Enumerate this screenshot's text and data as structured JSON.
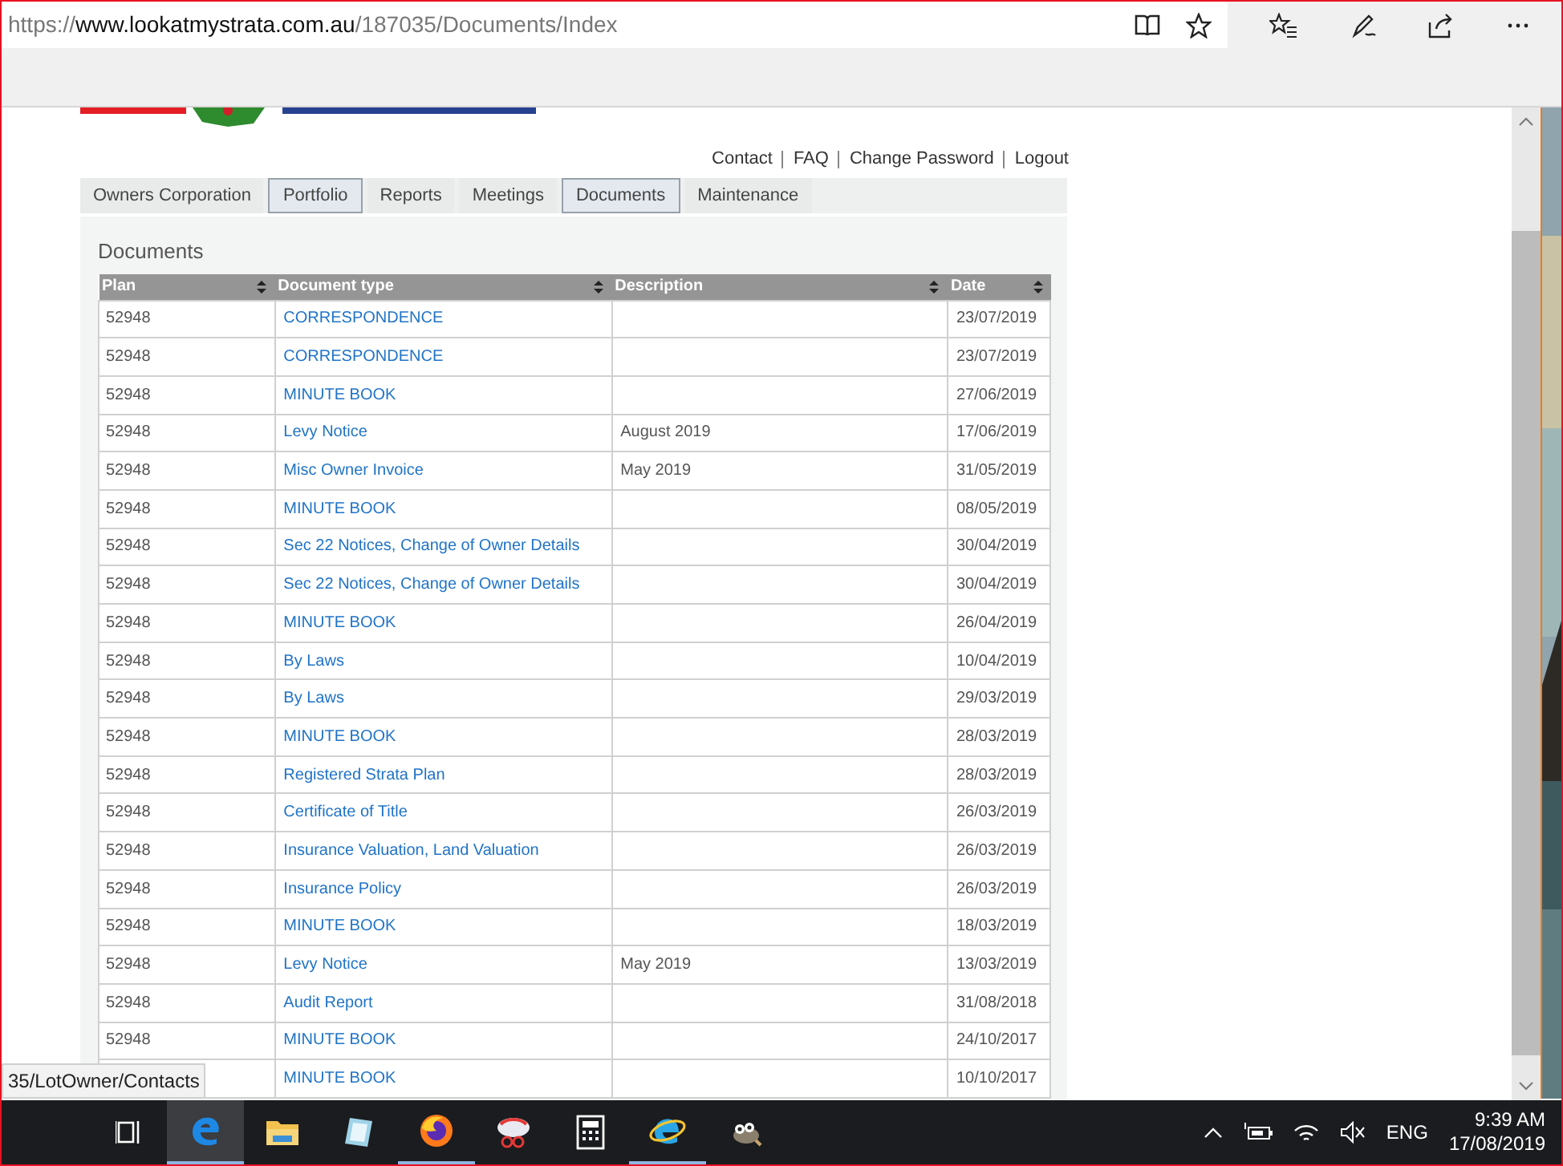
{
  "browser": {
    "address": {
      "scheme": "https://",
      "host": "www.lookatmystrata.com.au",
      "path": "/187035/Documents/Index"
    }
  },
  "nav_links": [
    "Contact",
    "FAQ",
    "Change Password",
    "Logout"
  ],
  "tabs": [
    {
      "label": "Owners Corporation",
      "selected": false
    },
    {
      "label": "Portfolio",
      "selected": true
    },
    {
      "label": "Reports",
      "selected": false
    },
    {
      "label": "Meetings",
      "selected": false
    },
    {
      "label": "Documents",
      "selected": true
    },
    {
      "label": "Maintenance",
      "selected": false
    }
  ],
  "panel_title": "Documents",
  "table": {
    "columns": [
      "Plan",
      "Document type",
      "Description",
      "Date"
    ],
    "rows": [
      {
        "plan": "52948",
        "document_type": "CORRESPONDENCE",
        "date": "23/07/2019"
      },
      {
        "plan": "52948",
        "document_type": "CORRESPONDENCE",
        "date": "23/07/2019"
      },
      {
        "plan": "52948",
        "document_type": "MINUTE BOOK",
        "date": "27/06/2019"
      },
      {
        "plan": "52948",
        "document_type": "Levy Notice",
        "description": "August 2019",
        "date": "17/06/2019"
      },
      {
        "plan": "52948",
        "document_type": "Misc Owner Invoice",
        "description": "May 2019",
        "date": "31/05/2019"
      },
      {
        "plan": "52948",
        "document_type": "MINUTE BOOK",
        "date": "08/05/2019"
      },
      {
        "plan": "52948",
        "document_type": "Sec 22 Notices, Change of Owner Details",
        "date": "30/04/2019"
      },
      {
        "plan": "52948",
        "document_type": "Sec 22 Notices, Change of Owner Details",
        "date": "30/04/2019"
      },
      {
        "plan": "52948",
        "document_type": "MINUTE BOOK",
        "date": "26/04/2019"
      },
      {
        "plan": "52948",
        "document_type": "By Laws",
        "date": "10/04/2019"
      },
      {
        "plan": "52948",
        "document_type": "By Laws",
        "date": "29/03/2019"
      },
      {
        "plan": "52948",
        "document_type": "MINUTE BOOK",
        "date": "28/03/2019"
      },
      {
        "plan": "52948",
        "document_type": "Registered Strata Plan",
        "date": "28/03/2019"
      },
      {
        "plan": "52948",
        "document_type": "Certificate of Title",
        "date": "26/03/2019"
      },
      {
        "plan": "52948",
        "document_type": "Insurance Valuation, Land Valuation",
        "date": "26/03/2019"
      },
      {
        "plan": "52948",
        "document_type": "Insurance Policy",
        "date": "26/03/2019"
      },
      {
        "plan": "52948",
        "document_type": "MINUTE BOOK",
        "date": "18/03/2019"
      },
      {
        "plan": "52948",
        "document_type": "Levy Notice",
        "description": "May 2019",
        "date": "13/03/2019"
      },
      {
        "plan": "52948",
        "document_type": "Audit Report",
        "date": "31/08/2018"
      },
      {
        "plan": "52948",
        "document_type": "MINUTE BOOK",
        "date": "24/10/2017"
      },
      {
        "document_type": "MINUTE BOOK",
        "date": "10/10/2017"
      }
    ]
  },
  "status_tooltip": "35/LotOwner/Contacts",
  "taskbar": {
    "apps": [
      {
        "kind": "taskview",
        "selected": false,
        "running": false
      },
      {
        "kind": "edge",
        "selected": true,
        "running": true
      },
      {
        "kind": "folder",
        "selected": false,
        "running": false
      },
      {
        "kind": "notepad",
        "selected": false,
        "running": false
      },
      {
        "kind": "firefox",
        "selected": false,
        "running": true
      },
      {
        "kind": "snip",
        "selected": false,
        "running": false
      },
      {
        "kind": "calculator",
        "selected": false,
        "running": false
      },
      {
        "kind": "ie",
        "selected": false,
        "running": true
      },
      {
        "kind": "gimp",
        "selected": false,
        "running": false
      }
    ],
    "tray": {
      "language": "ENG",
      "time": "9:39 AM",
      "date": "17/08/2019"
    }
  }
}
